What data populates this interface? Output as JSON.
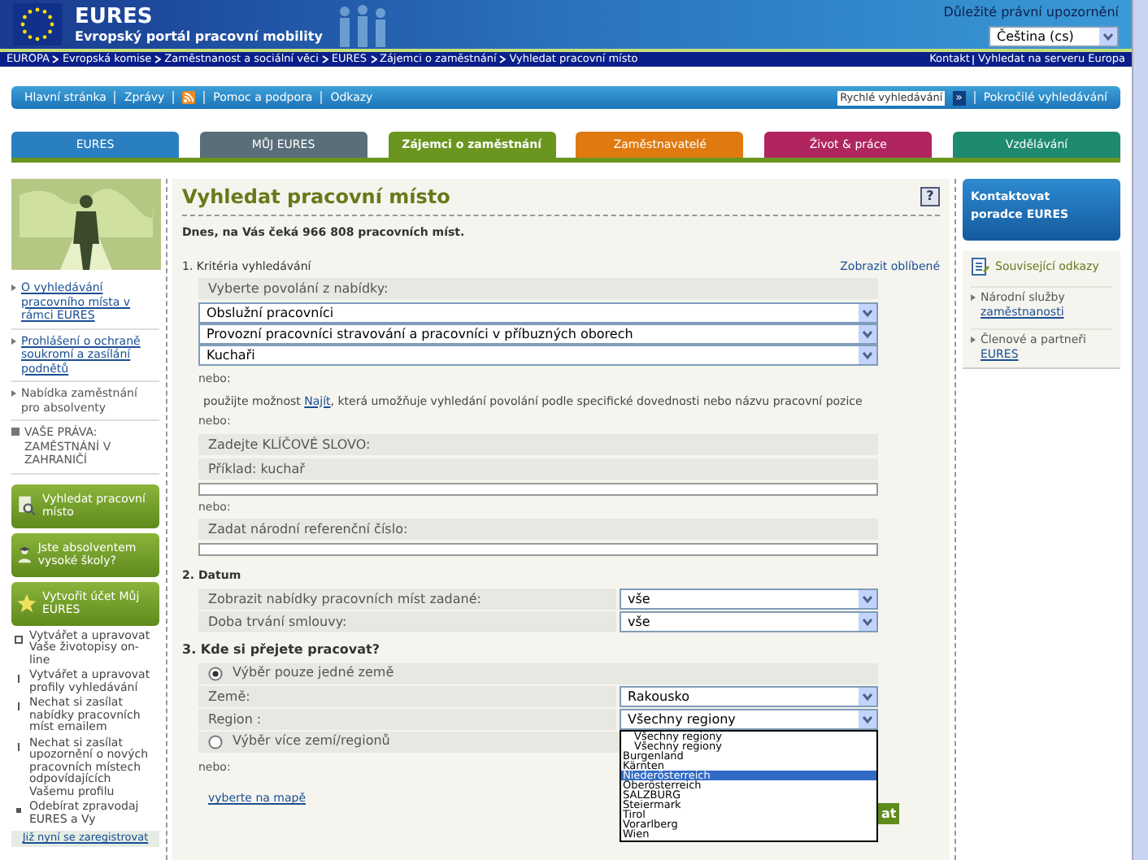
{
  "header": {
    "logo_title": "EURES",
    "subtitle": "Evropský portál pracovní mobility",
    "legal_link": "Důležité právní upozornění",
    "language": "Čeština (cs)"
  },
  "breadcrumb": [
    "EUROPA",
    "Evropská komise",
    "Zaměstnanost a sociální věci",
    "EURES",
    "Zájemci o zaměstnání",
    "Vyhledat pracovní místo"
  ],
  "top_links": [
    "Kontakt",
    "Vyhledat na serveru Europa"
  ],
  "nav": {
    "items": [
      {
        "kind": "link",
        "label": "Hlavní stránka"
      },
      {
        "kind": "link",
        "label": "Zprávy"
      },
      {
        "kind": "rss"
      },
      {
        "kind": "link",
        "label": "Pomoc a podpora"
      },
      {
        "kind": "link",
        "label": "Odkazy"
      }
    ],
    "search_placeholder": "Rychlé vyhledávání",
    "search_button": "»",
    "advanced": "Pokročilé vyhledávání"
  },
  "tabs": [
    {
      "label": "EURES",
      "color": "#2a7fc0",
      "selected": false
    },
    {
      "label": "MŮJ EURES",
      "color": "#5a6e7a",
      "selected": false
    },
    {
      "label": "Zájemci o zaměstnání",
      "color": "#6a961f",
      "selected": true
    },
    {
      "label": "Zaměstnavatelé",
      "color": "#e07a10",
      "selected": false
    },
    {
      "label": "Život & práce",
      "color": "#b0255f",
      "selected": false
    },
    {
      "label": "Vzdělávání",
      "color": "#1e8a70",
      "selected": false
    }
  ],
  "sidebar": {
    "links": [
      {
        "kind": "link",
        "text": "O vyhledávání pracovního místa v rámci EURES"
      },
      {
        "kind": "link",
        "text": "Prohlášení o ochraně soukromí a zasílání podnětů"
      },
      {
        "kind": "plain",
        "text": "Nabídka zaměstnání pro absolventy"
      },
      {
        "kind": "box",
        "text": "VAŠE PRÁVA: ZAMĚSTNÁNÍ V ZAHRANIČÍ"
      }
    ],
    "buttons": [
      {
        "label": "Vyhledat pracovní místo"
      },
      {
        "label": "Jste absolventem vysoké školy?"
      },
      {
        "label": "Vytvořit účet Můj EURES"
      }
    ],
    "features": [
      {
        "kind": "square",
        "text": "Vytvářet a upravovat Vaše životopisy on-line"
      },
      {
        "kind": "bar",
        "text": "Vytvářet a upravovat profily vyhledávání"
      },
      {
        "kind": "bar",
        "text": "Nechat si zasílat nabídky pracovních míst emailem"
      },
      {
        "kind": "bar",
        "text": "Nechat si zasílat upozornění o nových pracovních místech odpovídajících Vašemu profilu"
      },
      {
        "kind": "dot",
        "text": "Odebírat zpravodaj EURES a Vy"
      }
    ],
    "register_link": "Již nyní se zaregistrovat"
  },
  "main": {
    "title": "Vyhledat pracovní místo",
    "help": "?",
    "intro": "Dnes, na Vás čeká 966 808 pracovních míst.",
    "section1": {
      "heading": "1. Kritéria vyhledávání",
      "favorites": "Zobrazit oblíbené",
      "occupation_label": "Vyberte povolání z nabídky:",
      "selects": [
        "Obslužní pracovníci",
        "Provozní pracovníci stravování a pracovníci v příbuzných oborech",
        "Kuchaři"
      ],
      "or_1": "nebo:",
      "find_before": "použijte možnost",
      "find_link": "Najít",
      "find_after": ", která umožňuje vyhledání povolání podle specifické dovednosti nebo názvu pracovní pozice",
      "or_2": "nebo:",
      "keywords_label": "Zadejte KLÍČOVÉ SLOVO:",
      "keywords_example": "Příklad: kuchař",
      "or_3": "nebo:",
      "reference_label": "Zadat národní referenční číslo:"
    },
    "section2": {
      "heading": "2. Datum",
      "rows": [
        {
          "label": "Zobrazit nabídky pracovních míst zadané:",
          "value": "vše"
        },
        {
          "label": "Doba trvání smlouvy:",
          "value": "vše"
        }
      ]
    },
    "section3": {
      "heading": "3. Kde si přejete pracovat?",
      "radio_single": {
        "label": "Výběr pouze jedné země",
        "selected": true
      },
      "country_label": "Země:",
      "country": "Rakousko",
      "region_label": "Region :",
      "region": "Všechny regiony",
      "radio_multi": {
        "label": "Výběr více zemí/regionů",
        "selected": false
      },
      "or": "nebo:",
      "map_link": "vyberte na mapě",
      "region_options": [
        {
          "label": "Všechny regiony",
          "kind": "indented",
          "selected": false
        },
        {
          "label": "Všechny regiony",
          "kind": "indented",
          "selected": false
        },
        {
          "label": "Burgenland",
          "kind": "plain",
          "selected": false
        },
        {
          "label": "Kärnten",
          "kind": "plain",
          "selected": false
        },
        {
          "label": "Niederösterreich",
          "kind": "plain",
          "selected": true
        },
        {
          "label": "Oberösterreich",
          "kind": "plain",
          "selected": false
        },
        {
          "label": "SALZBURG",
          "kind": "plain",
          "selected": false
        },
        {
          "label": "Steiermark",
          "kind": "plain",
          "selected": false
        },
        {
          "label": "Tirol",
          "kind": "plain",
          "selected": false
        },
        {
          "label": "Vorarlberg",
          "kind": "plain",
          "selected": false
        },
        {
          "label": "Wien",
          "kind": "plain",
          "selected": false
        }
      ]
    },
    "search_button": "at"
  },
  "right": {
    "contact": [
      "Kontaktovat",
      "poradce EURES"
    ],
    "related_title": "Související odkazy",
    "related_links": [
      {
        "before": "Národní služby",
        "link": "zaměstnanosti"
      },
      {
        "before": "Členové a partneři",
        "link": "EURES"
      }
    ]
  }
}
